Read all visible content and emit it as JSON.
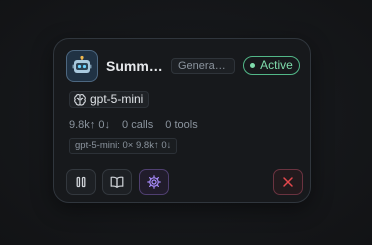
{
  "agent": {
    "name": "Summarizer",
    "category": "General Assistant",
    "status": "Active",
    "avatar_icon": "robot-icon",
    "model": "gpt-5-mini",
    "model_icon": "brain-icon"
  },
  "stats": {
    "tokens": "9.8k↑ 0↓",
    "calls": "0 calls",
    "tools": "0 tools"
  },
  "usage_breakdown": "gpt-5-mini: 0× 9.8k↑ 0↓",
  "actions": [
    {
      "name": "pause",
      "icon": "pause-icon"
    },
    {
      "name": "book",
      "icon": "book-icon"
    },
    {
      "name": "settings",
      "icon": "gear-icon"
    },
    {
      "name": "close",
      "icon": "close-icon"
    }
  ],
  "colors": {
    "active": "#52b788",
    "settings_accent": "#a78bfa",
    "danger": "#e5484d"
  }
}
